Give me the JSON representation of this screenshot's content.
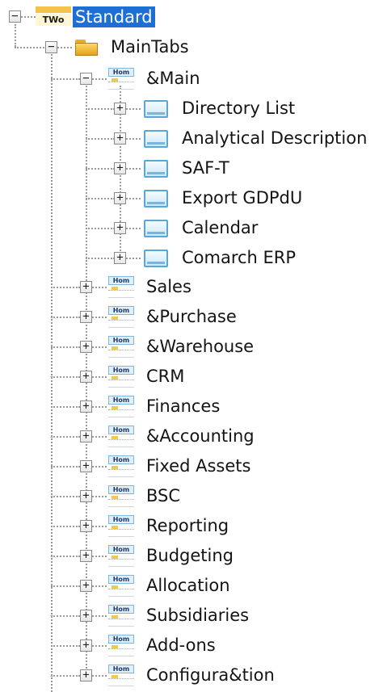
{
  "root": {
    "label": "Standard",
    "icon_text": "TWo",
    "expander": "−"
  },
  "main_tabs": {
    "label": "MainTabs",
    "expander": "−"
  },
  "main_group": {
    "label": "&Main",
    "icon_text": "Hom",
    "expander": "−"
  },
  "main_children": [
    {
      "label": "Directory List",
      "expander": "+"
    },
    {
      "label": "Analytical Description",
      "expander": "+"
    },
    {
      "label": "SAF-T",
      "expander": "+"
    },
    {
      "label": "Export GDPdU",
      "expander": "+"
    },
    {
      "label": "Calendar",
      "expander": "+"
    },
    {
      "label": "Comarch ERP",
      "expander": "+"
    }
  ],
  "tabs": [
    {
      "label": "Sales",
      "icon_text": "Hom",
      "expander": "+"
    },
    {
      "label": "&Purchase",
      "icon_text": "Hom",
      "expander": "+"
    },
    {
      "label": "&Warehouse",
      "icon_text": "Hom",
      "expander": "+"
    },
    {
      "label": "CRM",
      "icon_text": "Hom",
      "expander": "+"
    },
    {
      "label": "Finances",
      "icon_text": "Hom",
      "expander": "+"
    },
    {
      "label": "&Accounting",
      "icon_text": "Hom",
      "expander": "+"
    },
    {
      "label": "Fixed Assets",
      "icon_text": "Hom",
      "expander": "+"
    },
    {
      "label": "BSC",
      "icon_text": "Hom",
      "expander": "+"
    },
    {
      "label": "Reporting",
      "icon_text": "Hom",
      "expander": "+"
    },
    {
      "label": "Budgeting",
      "icon_text": "Hom",
      "expander": "+"
    },
    {
      "label": "Allocation",
      "icon_text": "Hom",
      "expander": "+"
    },
    {
      "label": "Subsidiaries",
      "icon_text": "Hom",
      "expander": "+"
    },
    {
      "label": "Add-ons",
      "icon_text": "Hom",
      "expander": "+"
    },
    {
      "label": "Configura&tion",
      "icon_text": "Hom",
      "expander": "+"
    }
  ],
  "colors": {
    "selection": "#1d6fd6",
    "folder": "#f5c542",
    "form_icon": "#5aa7d6",
    "lines": "#9a9a9a"
  },
  "icons": {
    "root": "toolbar-icon",
    "group": "folder-icon",
    "tab": "tab-page-icon",
    "form": "window-form-icon"
  }
}
